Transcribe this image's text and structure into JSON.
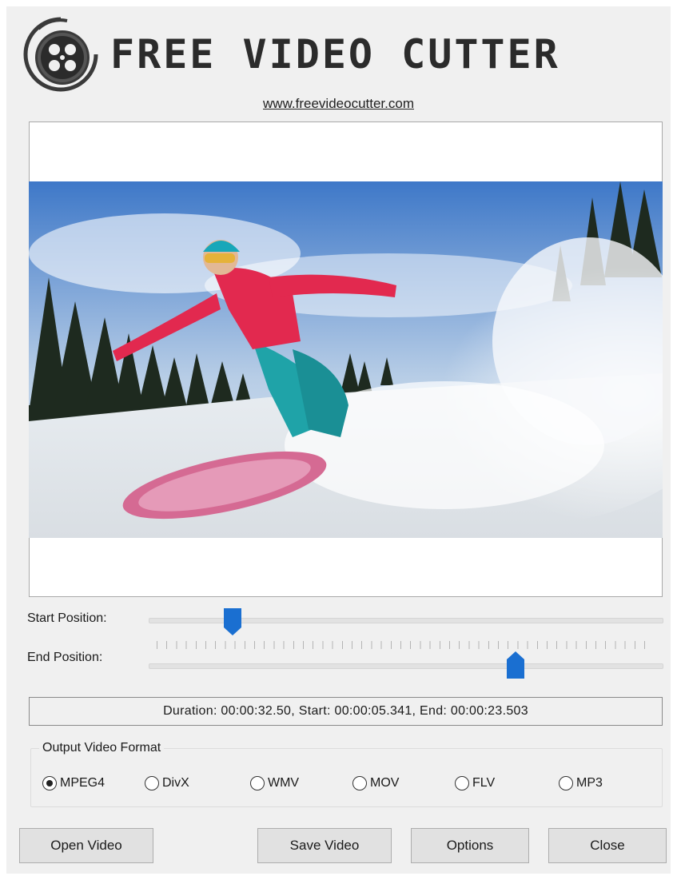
{
  "header": {
    "title": "FREE VIDEO CUTTER",
    "website": "www.freevideocutter.com",
    "logo_icon": "film-reel-icon"
  },
  "sliders": {
    "start_label": "Start Position:",
    "end_label": "End Position:",
    "start_fraction": 0.164,
    "end_fraction": 0.715
  },
  "info": {
    "text": "Duration: 00:00:32.50, Start: 00:00:05.341, End: 00:00:23.503"
  },
  "format": {
    "legend": "Output Video Format",
    "selected": "MPEG4",
    "options": [
      "MPEG4",
      "DivX",
      "WMV",
      "MOV",
      "FLV",
      "MP3"
    ]
  },
  "buttons": {
    "open": "Open Video",
    "save": "Save Video",
    "options": "Options",
    "close": "Close"
  },
  "colors": {
    "accent": "#1a6fd1",
    "window_bg": "#f0f0f0"
  }
}
